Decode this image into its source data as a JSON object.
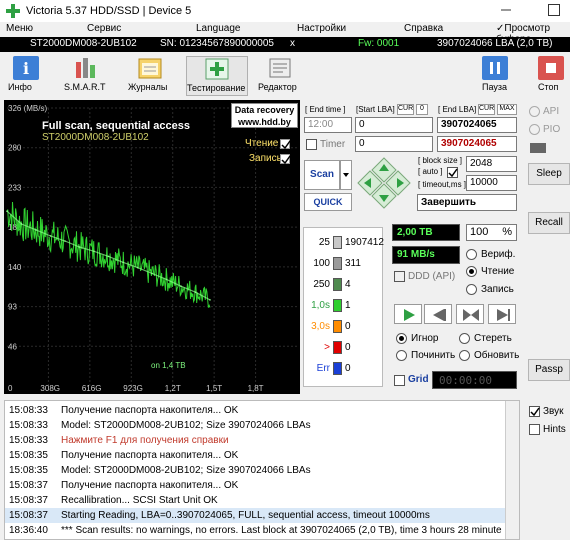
{
  "window": {
    "title": "Victoria 5.37 HDD/SSD | Device 5"
  },
  "menu": [
    "Меню",
    "Сервис",
    "Language",
    "Настройки",
    "Справка"
  ],
  "menu_right": "Просмотр буфера",
  "infobar": {
    "model": "ST2000DM008-2UB102",
    "serial": "SN: 01234567890000005",
    "close": "x",
    "firmware": "Fw: 0001",
    "lba": "3907024066 LBA (2,0 TB)"
  },
  "toolbar": {
    "buttons": [
      "Инфо",
      "S.M.A.R.T",
      "Журналы",
      "Тестирование",
      "Редактор"
    ],
    "pause": "Пауза",
    "stop": "Стоп"
  },
  "chart": {
    "header_title": "Full scan, sequential access",
    "header_model": "ST2000DM008-2UB102",
    "badge_line1": "Data recovery",
    "badge_line2": "www.hdd.by",
    "legend_read": "Чтение",
    "legend_write": "Запись",
    "on_label": "on 1,4 TB"
  },
  "chart_data": {
    "type": "line",
    "title": "Full scan, sequential access",
    "xlabel": "",
    "ylabel": "",
    "x_ticks": [
      "0",
      "308G",
      "616G",
      "923G",
      "1,2T",
      "1,5T",
      "1,8T"
    ],
    "y_ticks": [
      "326 (MB/s)",
      "280",
      "233",
      "186",
      "140",
      "93",
      "46"
    ],
    "ylim": [
      0,
      326
    ],
    "xlim": [
      0,
      2.0
    ],
    "grid": true,
    "series": [
      {
        "name": "Чтение",
        "x": [
          0.0,
          0.1,
          0.2,
          0.3,
          0.4,
          0.5,
          0.6,
          0.7,
          0.8,
          0.9,
          1.0,
          1.1,
          1.2,
          1.3,
          1.4
        ],
        "y": [
          205,
          190,
          183,
          176,
          170,
          163,
          158,
          152,
          145,
          139,
          132,
          125,
          117,
          110,
          101
        ]
      }
    ]
  },
  "lba_panel": {
    "end_time_label": "[ End time ]",
    "start_lba_label": "[Start LBA]",
    "cur_label": "CUR",
    "zero_label": "0",
    "end_lba_label": "[ End LBA]",
    "max_label": "MAX",
    "time_value": "12:00",
    "start_lba_value": "0",
    "end_lba_value": "3907024065",
    "timer_label": "Timer",
    "timer_value": "0",
    "cur_lba_value": "3907024065",
    "scan_label": "Scan",
    "quick_label": "QUICK",
    "block_size_label": "[ block size ]",
    "auto_label": "[ auto ]",
    "block_size_value": "2048",
    "timeout_label": "[ timeout,ms ]",
    "timeout_value": "10000",
    "finish_label": "Завершить"
  },
  "timeline": [
    {
      "k": "25",
      "color": "#c8c8c8",
      "v": "1907412"
    },
    {
      "k": "100",
      "color": "#9a9a9a",
      "v": "311"
    },
    {
      "k": "250",
      "color": "#4f8a4f",
      "v": "4"
    },
    {
      "k": "1,0s",
      "color": "#2fcf2f",
      "v": "1"
    },
    {
      "k": "3,0s",
      "color": "#ff8c00",
      "v": "0"
    },
    {
      "k": ">",
      "color": "#e00000",
      "v": "0"
    },
    {
      "k": "Err",
      "color": "#1a3fd6",
      "v": "0"
    }
  ],
  "stats": {
    "size": "2,00 TB",
    "percent": "100",
    "percent_unit": "%",
    "speed": "91 MB/s",
    "ddd": "DDD (API)",
    "verify": "Вериф.",
    "read": "Чтение",
    "write": "Запись"
  },
  "repair": {
    "ignore": "Игнор",
    "erase": "Стереть",
    "repair": "Починить",
    "refresh": "Обновить",
    "grid": "Grid",
    "clock": "00:00:00"
  },
  "side": {
    "api": "API",
    "pio": "PIO",
    "sleep": "Sleep",
    "recall": "Recall",
    "passp": "Passp",
    "sound": "Звук",
    "hints": "Hints"
  },
  "log": [
    {
      "t": "15:08:33",
      "m": "Получение паспорта накопителя... OK",
      "color": "#000000"
    },
    {
      "t": "15:08:33",
      "m": "Model: ST2000DM008-2UB102; Size 3907024066 LBAs",
      "color": "#000000"
    },
    {
      "t": "15:08:33",
      "m": "Нажмите F1 для получения справки",
      "color": "#c0392b"
    },
    {
      "t": "15:08:35",
      "m": "Получение паспорта накопителя... OK",
      "color": "#000000"
    },
    {
      "t": "15:08:35",
      "m": "Model: ST2000DM008-2UB102; Size 3907024066 LBAs",
      "color": "#000000"
    },
    {
      "t": "15:08:37",
      "m": "Получение паспорта накопителя... OK",
      "color": "#000000"
    },
    {
      "t": "15:08:37",
      "m": "Recallibration... SCSI  Start Unit OK",
      "color": "#000000"
    },
    {
      "t": "15:08:37",
      "m": "Starting Reading, LBA=0..3907024065, FULL, sequential access, timeout 10000ms",
      "color": "#000000"
    },
    {
      "t": "18:36:40",
      "m": "*** Scan results: no warnings, no errors. Last block at 3907024065 (2,0 TB), time 3 hours 28 minute",
      "color": "#000000"
    }
  ]
}
